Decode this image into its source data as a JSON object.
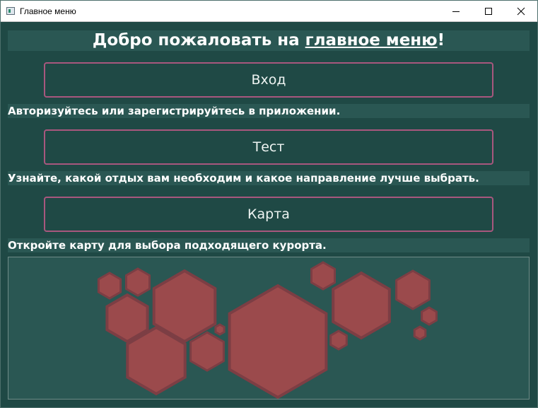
{
  "window": {
    "title": "Главное меню",
    "controls": [
      "minimize-icon",
      "maximize-icon",
      "close-icon"
    ]
  },
  "header": {
    "prefix": "Добро пожаловать на ",
    "link": "главное меню",
    "suffix": "!"
  },
  "menu": [
    {
      "label": "Вход",
      "description": "Авторизуйтесь или зарегистрируйтесь в приложении."
    },
    {
      "label": "Тест",
      "description": "Узнайте, какой отдых вам необходим и какое направление лучше выбрать."
    },
    {
      "label": "Карта",
      "description": "Откройте карту для выбора подходящего курорта."
    }
  ],
  "colors": {
    "background": "#1f4945",
    "band": "#2a5753",
    "button_border": "#a8577e",
    "hexagon_fill": "#9b4a4c",
    "hexagon_stroke": "#7c3e44"
  }
}
